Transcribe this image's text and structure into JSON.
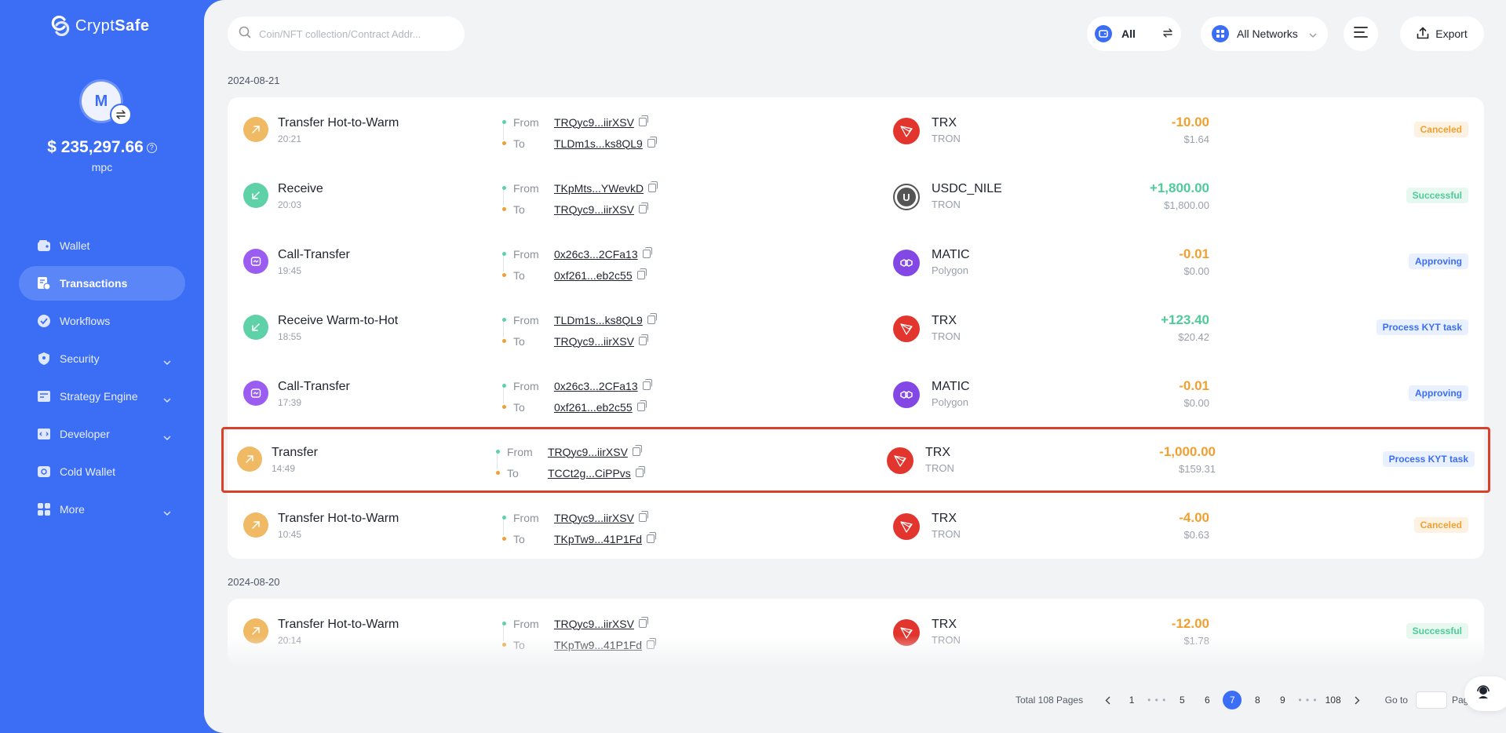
{
  "app": {
    "name_light": "Crypt",
    "name_bold": "Safe"
  },
  "account": {
    "initial": "M",
    "balance": "$ 235,297.66",
    "name": "mpc",
    "help": "?"
  },
  "nav": [
    {
      "label": "Wallet",
      "icon": "wallet-icon",
      "active": false,
      "expandable": false
    },
    {
      "label": "Transactions",
      "icon": "transactions-icon",
      "active": true,
      "expandable": false
    },
    {
      "label": "Workflows",
      "icon": "workflows-icon",
      "active": false,
      "expandable": false
    },
    {
      "label": "Security",
      "icon": "shield-icon",
      "active": false,
      "expandable": true
    },
    {
      "label": "Strategy Engine",
      "icon": "strategy-icon",
      "active": false,
      "expandable": true
    },
    {
      "label": "Developer",
      "icon": "code-icon",
      "active": false,
      "expandable": true
    },
    {
      "label": "Cold Wallet",
      "icon": "cold-wallet-icon",
      "active": false,
      "expandable": false
    },
    {
      "label": "More",
      "icon": "grid-icon",
      "active": false,
      "expandable": true
    }
  ],
  "toolbar": {
    "search_placeholder": "Coin/NFT collection/Contract Addr...",
    "filter_all": "All",
    "filter_network": "All Networks",
    "export": "Export"
  },
  "labels": {
    "from": "From",
    "to": "To"
  },
  "groups": [
    {
      "date": "2024-08-21",
      "rows": [
        {
          "type": "Transfer Hot-to-Warm",
          "time": "20:21",
          "dir": "out",
          "from": "TRQyc9...iirXSV",
          "to": "TLDm1s...ks8QL9",
          "coin": "TRX",
          "network": "TRON",
          "coin_icon": "trx",
          "amount": "-10.00",
          "sign": "neg",
          "usd": "$1.64",
          "status": "Canceled",
          "status_kind": "canceled",
          "highlight": false
        },
        {
          "type": "Receive",
          "time": "20:03",
          "dir": "in",
          "from": "TKpMts...YWevkD",
          "to": "TRQyc9...iirXSV",
          "coin": "USDC_NILE",
          "network": "TRON",
          "coin_icon": "usdc",
          "amount": "+1,800.00",
          "sign": "pos",
          "usd": "$1,800.00",
          "status": "Successful",
          "status_kind": "successful",
          "highlight": false
        },
        {
          "type": "Call-Transfer",
          "time": "19:45",
          "dir": "call",
          "from": "0x26c3...2CFa13",
          "to": "0xf261...eb2c55",
          "coin": "MATIC",
          "network": "Polygon",
          "coin_icon": "matic",
          "amount": "-0.01",
          "sign": "neg",
          "usd": "$0.00",
          "status": "Approving",
          "status_kind": "approving",
          "highlight": false
        },
        {
          "type": "Receive Warm-to-Hot",
          "time": "18:55",
          "dir": "in",
          "from": "TLDm1s...ks8QL9",
          "to": "TRQyc9...iirXSV",
          "coin": "TRX",
          "network": "TRON",
          "coin_icon": "trx",
          "amount": "+123.40",
          "sign": "pos",
          "usd": "$20.42",
          "status": "Process KYT task",
          "status_kind": "kyt",
          "highlight": false
        },
        {
          "type": "Call-Transfer",
          "time": "17:39",
          "dir": "call",
          "from": "0x26c3...2CFa13",
          "to": "0xf261...eb2c55",
          "coin": "MATIC",
          "network": "Polygon",
          "coin_icon": "matic",
          "amount": "-0.01",
          "sign": "neg",
          "usd": "$0.00",
          "status": "Approving",
          "status_kind": "approving",
          "highlight": false
        },
        {
          "type": "Transfer",
          "time": "14:49",
          "dir": "out",
          "from": "TRQyc9...iirXSV",
          "to": "TCCt2g...CiPPvs",
          "coin": "TRX",
          "network": "TRON",
          "coin_icon": "trx",
          "amount": "-1,000.00",
          "sign": "neg",
          "usd": "$159.31",
          "status": "Process KYT task",
          "status_kind": "kyt",
          "highlight": true
        },
        {
          "type": "Transfer Hot-to-Warm",
          "time": "10:45",
          "dir": "out",
          "from": "TRQyc9...iirXSV",
          "to": "TKpTw9...41P1Fd",
          "coin": "TRX",
          "network": "TRON",
          "coin_icon": "trx",
          "amount": "-4.00",
          "sign": "neg",
          "usd": "$0.63",
          "status": "Canceled",
          "status_kind": "canceled",
          "highlight": false
        }
      ]
    },
    {
      "date": "2024-08-20",
      "rows": [
        {
          "type": "Transfer Hot-to-Warm",
          "time": "20:14",
          "dir": "out",
          "from": "TRQyc9...iirXSV",
          "to": "TKpTw9...41P1Fd",
          "coin": "TRX",
          "network": "TRON",
          "coin_icon": "trx",
          "amount": "-12.00",
          "sign": "neg",
          "usd": "$1.78",
          "status": "Successful",
          "status_kind": "successful",
          "highlight": false
        }
      ]
    }
  ],
  "pagination": {
    "total": "Total 108 Pages",
    "pages": [
      "1",
      "...",
      "5",
      "6",
      "7",
      "8",
      "9",
      "...",
      "108"
    ],
    "current": "7",
    "goto": "Go to",
    "page": "Page"
  },
  "colors": {
    "brand": "#3b6ef5",
    "outgoing": "#f0a030",
    "incoming": "#4ecb98",
    "highlight": "#d9412b"
  }
}
